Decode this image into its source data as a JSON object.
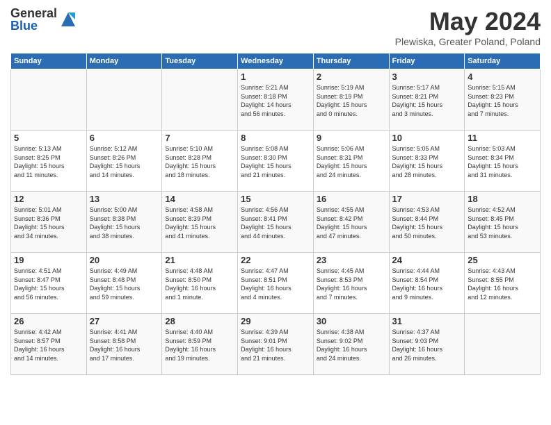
{
  "logo": {
    "general": "General",
    "blue": "Blue"
  },
  "title": "May 2024",
  "subtitle": "Plewiska, Greater Poland, Poland",
  "days_of_week": [
    "Sunday",
    "Monday",
    "Tuesday",
    "Wednesday",
    "Thursday",
    "Friday",
    "Saturday"
  ],
  "weeks": [
    [
      {
        "day": "",
        "info": ""
      },
      {
        "day": "",
        "info": ""
      },
      {
        "day": "",
        "info": ""
      },
      {
        "day": "1",
        "info": "Sunrise: 5:21 AM\nSunset: 8:18 PM\nDaylight: 14 hours\nand 56 minutes."
      },
      {
        "day": "2",
        "info": "Sunrise: 5:19 AM\nSunset: 8:19 PM\nDaylight: 15 hours\nand 0 minutes."
      },
      {
        "day": "3",
        "info": "Sunrise: 5:17 AM\nSunset: 8:21 PM\nDaylight: 15 hours\nand 3 minutes."
      },
      {
        "day": "4",
        "info": "Sunrise: 5:15 AM\nSunset: 8:23 PM\nDaylight: 15 hours\nand 7 minutes."
      }
    ],
    [
      {
        "day": "5",
        "info": "Sunrise: 5:13 AM\nSunset: 8:25 PM\nDaylight: 15 hours\nand 11 minutes."
      },
      {
        "day": "6",
        "info": "Sunrise: 5:12 AM\nSunset: 8:26 PM\nDaylight: 15 hours\nand 14 minutes."
      },
      {
        "day": "7",
        "info": "Sunrise: 5:10 AM\nSunset: 8:28 PM\nDaylight: 15 hours\nand 18 minutes."
      },
      {
        "day": "8",
        "info": "Sunrise: 5:08 AM\nSunset: 8:30 PM\nDaylight: 15 hours\nand 21 minutes."
      },
      {
        "day": "9",
        "info": "Sunrise: 5:06 AM\nSunset: 8:31 PM\nDaylight: 15 hours\nand 24 minutes."
      },
      {
        "day": "10",
        "info": "Sunrise: 5:05 AM\nSunset: 8:33 PM\nDaylight: 15 hours\nand 28 minutes."
      },
      {
        "day": "11",
        "info": "Sunrise: 5:03 AM\nSunset: 8:34 PM\nDaylight: 15 hours\nand 31 minutes."
      }
    ],
    [
      {
        "day": "12",
        "info": "Sunrise: 5:01 AM\nSunset: 8:36 PM\nDaylight: 15 hours\nand 34 minutes."
      },
      {
        "day": "13",
        "info": "Sunrise: 5:00 AM\nSunset: 8:38 PM\nDaylight: 15 hours\nand 38 minutes."
      },
      {
        "day": "14",
        "info": "Sunrise: 4:58 AM\nSunset: 8:39 PM\nDaylight: 15 hours\nand 41 minutes."
      },
      {
        "day": "15",
        "info": "Sunrise: 4:56 AM\nSunset: 8:41 PM\nDaylight: 15 hours\nand 44 minutes."
      },
      {
        "day": "16",
        "info": "Sunrise: 4:55 AM\nSunset: 8:42 PM\nDaylight: 15 hours\nand 47 minutes."
      },
      {
        "day": "17",
        "info": "Sunrise: 4:53 AM\nSunset: 8:44 PM\nDaylight: 15 hours\nand 50 minutes."
      },
      {
        "day": "18",
        "info": "Sunrise: 4:52 AM\nSunset: 8:45 PM\nDaylight: 15 hours\nand 53 minutes."
      }
    ],
    [
      {
        "day": "19",
        "info": "Sunrise: 4:51 AM\nSunset: 8:47 PM\nDaylight: 15 hours\nand 56 minutes."
      },
      {
        "day": "20",
        "info": "Sunrise: 4:49 AM\nSunset: 8:48 PM\nDaylight: 15 hours\nand 59 minutes."
      },
      {
        "day": "21",
        "info": "Sunrise: 4:48 AM\nSunset: 8:50 PM\nDaylight: 16 hours\nand 1 minute."
      },
      {
        "day": "22",
        "info": "Sunrise: 4:47 AM\nSunset: 8:51 PM\nDaylight: 16 hours\nand 4 minutes."
      },
      {
        "day": "23",
        "info": "Sunrise: 4:45 AM\nSunset: 8:53 PM\nDaylight: 16 hours\nand 7 minutes."
      },
      {
        "day": "24",
        "info": "Sunrise: 4:44 AM\nSunset: 8:54 PM\nDaylight: 16 hours\nand 9 minutes."
      },
      {
        "day": "25",
        "info": "Sunrise: 4:43 AM\nSunset: 8:55 PM\nDaylight: 16 hours\nand 12 minutes."
      }
    ],
    [
      {
        "day": "26",
        "info": "Sunrise: 4:42 AM\nSunset: 8:57 PM\nDaylight: 16 hours\nand 14 minutes."
      },
      {
        "day": "27",
        "info": "Sunrise: 4:41 AM\nSunset: 8:58 PM\nDaylight: 16 hours\nand 17 minutes."
      },
      {
        "day": "28",
        "info": "Sunrise: 4:40 AM\nSunset: 8:59 PM\nDaylight: 16 hours\nand 19 minutes."
      },
      {
        "day": "29",
        "info": "Sunrise: 4:39 AM\nSunset: 9:01 PM\nDaylight: 16 hours\nand 21 minutes."
      },
      {
        "day": "30",
        "info": "Sunrise: 4:38 AM\nSunset: 9:02 PM\nDaylight: 16 hours\nand 24 minutes."
      },
      {
        "day": "31",
        "info": "Sunrise: 4:37 AM\nSunset: 9:03 PM\nDaylight: 16 hours\nand 26 minutes."
      },
      {
        "day": "",
        "info": ""
      }
    ]
  ]
}
